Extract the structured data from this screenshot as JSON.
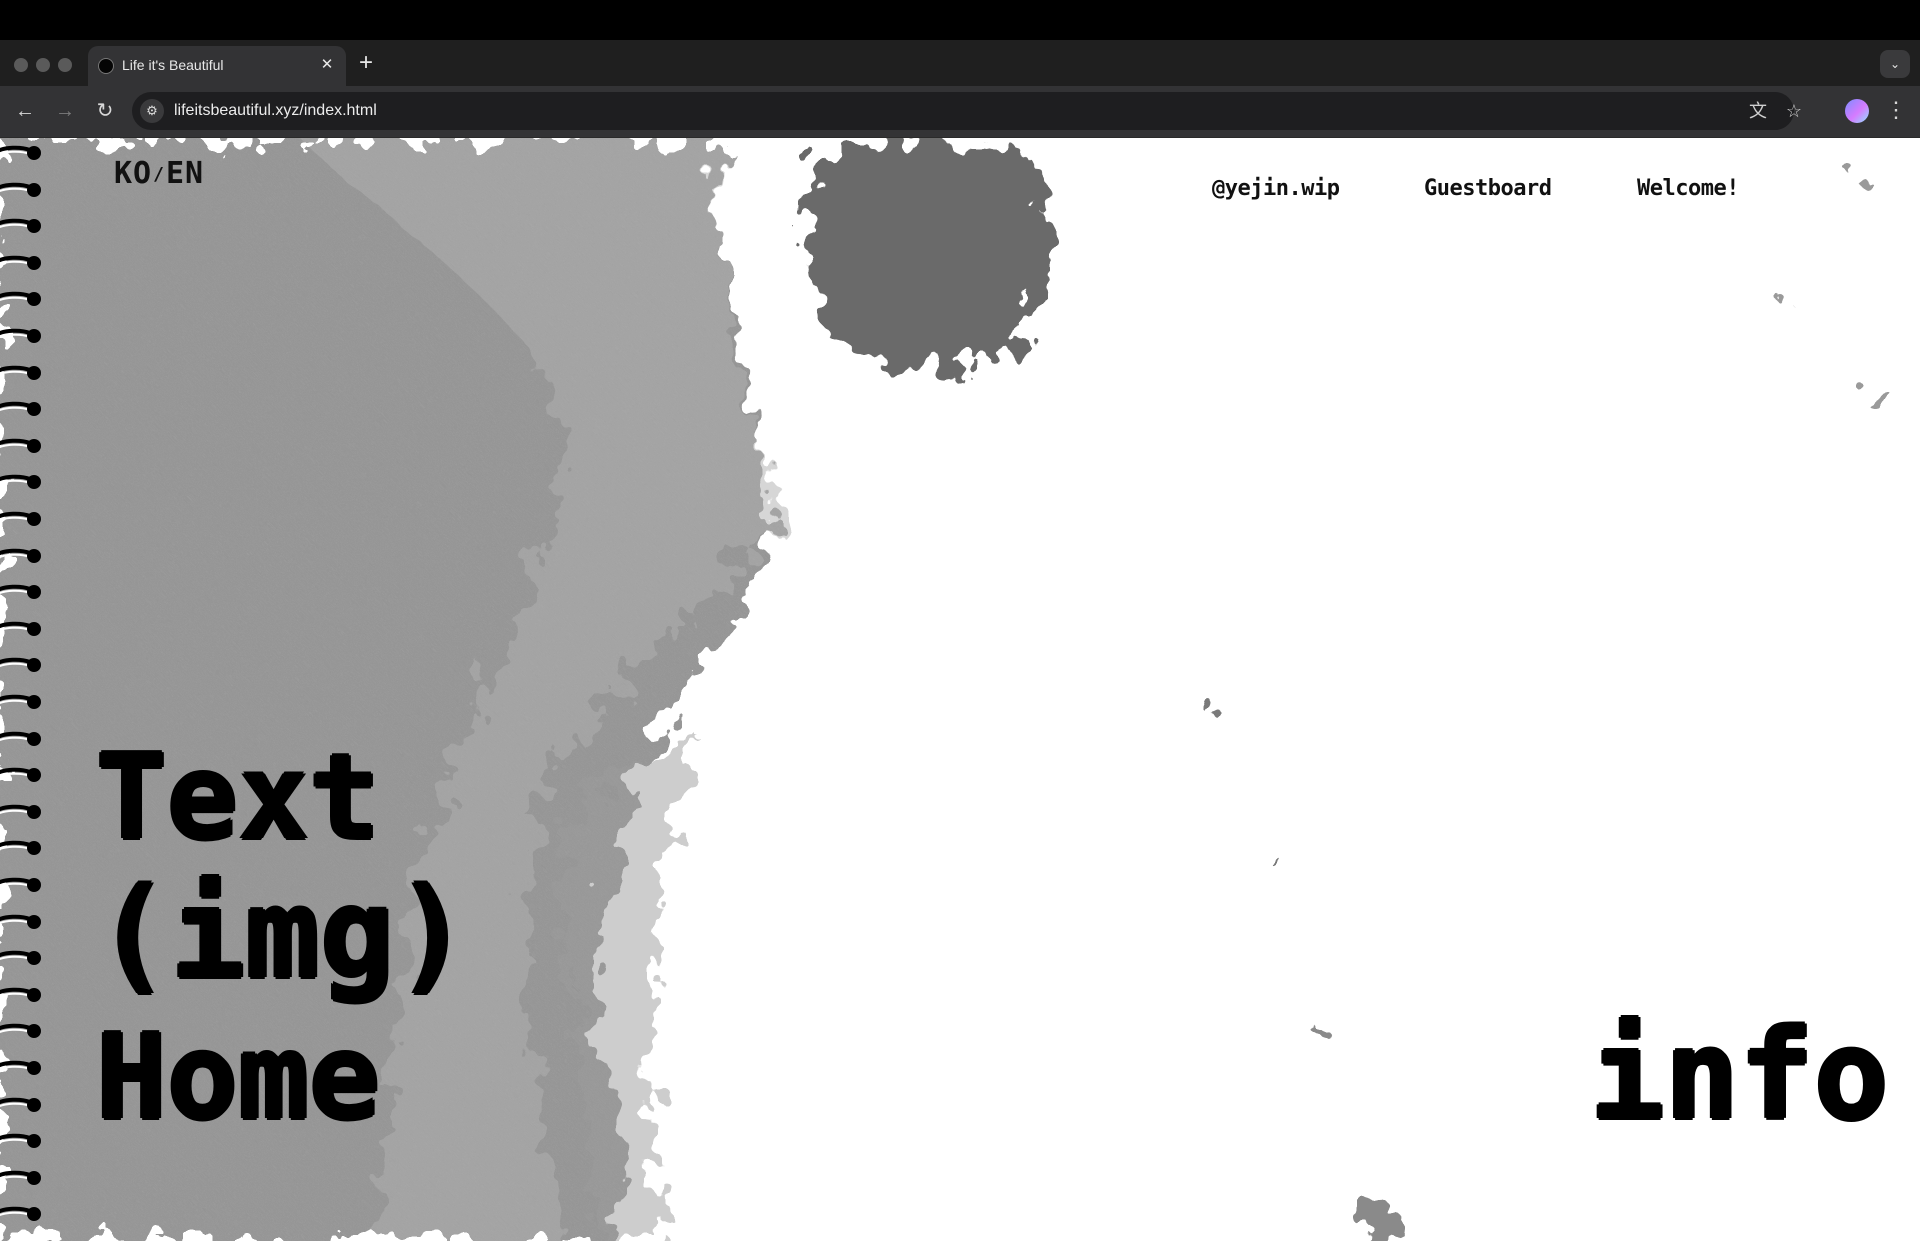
{
  "browser": {
    "tab": {
      "title": "Life it's Beautiful",
      "close": "✕"
    },
    "new_tab": "+",
    "tab_menu": "⌄",
    "nav": {
      "back": "←",
      "forward": "→",
      "reload": "↻"
    },
    "site_info": "⚙",
    "url": "lifeitsbeautiful.xyz/index.html",
    "translate": "文",
    "bookmark": "☆",
    "menu": "⋮"
  },
  "page": {
    "lang": {
      "ko": "KO",
      "sep": "/",
      "en": "EN"
    },
    "nav": {
      "instagram": "@yejin.wip",
      "guestboard": "Guestboard",
      "welcome": "Welcome!"
    },
    "menu": {
      "line1": "Text",
      "line2": "(img)",
      "line3": "Home",
      "info": "info"
    }
  },
  "colors": {
    "chrome_bg": "#1f1f1f",
    "toolbar_bg": "#333335",
    "page_bg": "#ffffff",
    "ink": "#000000"
  },
  "icons": [
    "traffic-light",
    "favicon",
    "close-icon",
    "plus-icon",
    "chevron-down-icon",
    "back-arrow-icon",
    "forward-arrow-icon",
    "reload-icon",
    "site-settings-icon",
    "translate-icon",
    "star-icon",
    "profile-avatar",
    "kebab-menu-icon",
    "spiral-binding"
  ]
}
